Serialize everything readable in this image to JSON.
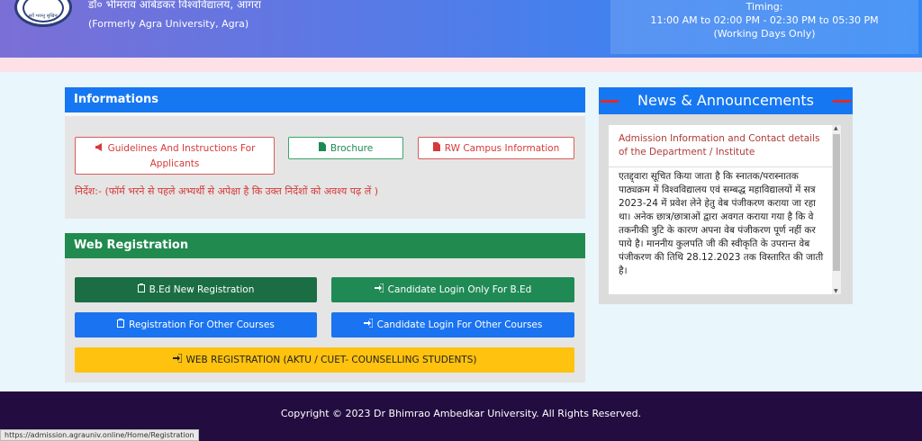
{
  "header": {
    "logo_text": "सर्वे भवन्तु सुखिनः",
    "university_name_hindi": "डॉ० भीमराव आंबेडकर विश्वविद्यालय, आगरा",
    "formerly": "(Formerly Agra University, Agra)",
    "timing_label": "Timing:",
    "timing_hours": "11:00 AM to 02:00 PM - 02:30 PM to 05:30 PM",
    "timing_note": "(Working Days Only)"
  },
  "informations": {
    "title": "Informations",
    "guidelines_label": "Guidelines And Instructions For Applicants",
    "brochure_label": "Brochure",
    "rw_campus_label": "RW Campus Information",
    "note": "निर्देश:- (फॉर्म भरने से पहले अभ्यर्थी से अपेक्षा है कि उक्त निर्देशों को अवश्य पढ़ लें )"
  },
  "web_registration": {
    "title": "Web Registration",
    "bed_new_label": "B.Ed New Registration",
    "bed_login_label": "Candidate Login Only For B.Ed",
    "other_reg_label": "Registration For Other Courses",
    "other_login_label": "Candidate Login For Other Courses",
    "aktu_label": "WEB REGISTRATION (AKTU / CUET- COUNSELLING STUDENTS)"
  },
  "news": {
    "title": "News & Announcements",
    "item_title": "Admission Information and Contact details of the Department / Institute",
    "item_text": "एतद्द्वारा सूचित किया जाता है कि स्नातक/परास्नातक पाठ्यक्रम में विश्वविद्यालय एवं सम्बद्ध महाविद्यालयों में सत्र 2023-24 में प्रवेश लेने हेतु वेब पंजीकरण कराया जा रहा था। अनेक छात्र/छात्राओं द्वारा अवगत कराया गया है कि वे तकनीकी त्रुटि के कारण अपना वेब पंजीकरण पूर्ण नहीं कर पाये है। माननीय कुलपति जी की स्वीकृति के उपरान्त वेब पंजीकरण की तिथि 28.12.2023 तक विस्तारित की जाती है।"
  },
  "footer": {
    "copyright": "Copyright © 2023 Dr Bhimrao Ambedkar University. All Rights Reserved."
  },
  "status_bar": {
    "url": "https://admission.agrauniv.online/Home/Registration"
  },
  "icons": {
    "guidelines": "megaphone-icon",
    "brochure": "file-icon",
    "rw_campus": "file-pdf-icon",
    "registration": "clipboard-icon",
    "login": "sign-in-icon"
  },
  "colors": {
    "primary_blue": "#1677f2",
    "success_green": "#218a4f",
    "warning_yellow": "#ffc20e",
    "danger_red": "#d63a3a",
    "footer_bg": "#230d40"
  }
}
